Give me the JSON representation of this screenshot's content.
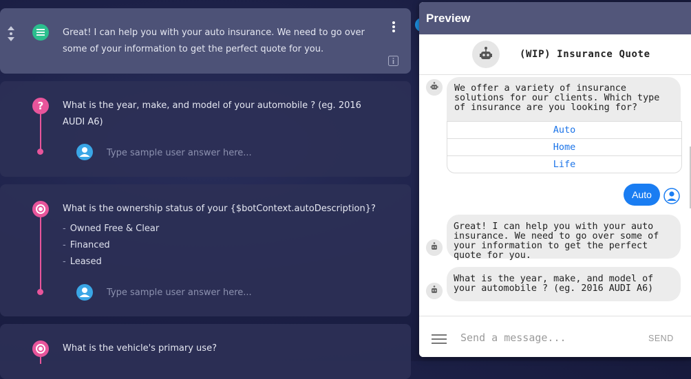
{
  "cards": [
    {
      "text": "Great! I can help you with your auto insurance. We need to go over some of your information to get the perfect quote for you."
    },
    {
      "question": "What is the year, make, and model of your automobile ? (eg. 2016 AUDI A6)",
      "sample_placeholder": "Type sample user answer here..."
    },
    {
      "question": "What is the ownership status of your {$botContext.autoDescription}?",
      "options": [
        "Owned Free & Clear",
        "Financed",
        "Leased"
      ],
      "sample_placeholder": "Type sample user answer here..."
    },
    {
      "question": "What is the vehicle's primary use?"
    }
  ],
  "preview": {
    "title": "Preview",
    "bot_name": "(WIP) Insurance Quote",
    "messages": {
      "m1": "We offer a variety of insurance solutions for our clients. Which type of insurance are you looking for?",
      "options": [
        "Auto",
        "Home",
        "Life"
      ],
      "user_reply": "Auto",
      "m2": "Great! I can help you with your auto insurance. We need to go over some of your information to get the perfect quote for you.",
      "m3": "What is the year, make, and model of your automobile ? (eg. 2016 AUDI A6)"
    },
    "composer_placeholder": "Send a message...",
    "send_label": "SEND"
  },
  "colors": {
    "accent_pink": "#e8559b",
    "accent_green": "#2bbf8e",
    "user_blue": "#1a7df2"
  },
  "icons": [
    "drag-handle-icon",
    "message-lines-icon",
    "more-vert-icon",
    "info-icon",
    "question-icon",
    "radio-target-icon",
    "user-icon",
    "robot-icon",
    "menu-icon"
  ]
}
